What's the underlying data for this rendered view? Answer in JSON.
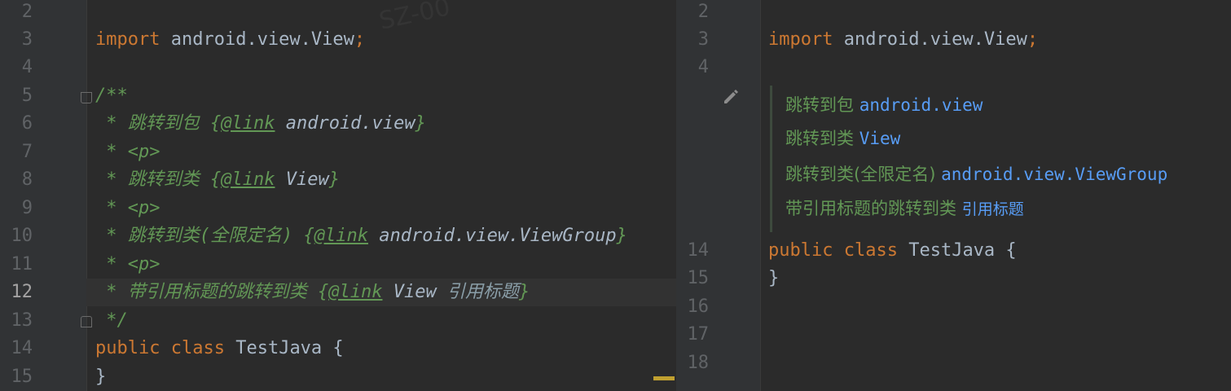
{
  "left": {
    "watermark": "SZ-00",
    "line_numbers": [
      "2",
      "3",
      "4",
      "5",
      "6",
      "7",
      "8",
      "9",
      "10",
      "11",
      "12",
      "13",
      "14",
      "15"
    ],
    "current_line": "12",
    "code": {
      "l3": {
        "import": "import",
        "pkg": " android.view.View",
        "semi": ";"
      },
      "l5": "/**",
      "l6": {
        "star": " * 跳转到包 ",
        "open": "{",
        "tag": "@link",
        "name": " android.view",
        "close": "}"
      },
      "l7": {
        "star": " * ",
        "p": "<p>"
      },
      "l8": {
        "star": " * 跳转到类 ",
        "open": "{",
        "tag": "@link",
        "name": " View",
        "close": "}"
      },
      "l9": {
        "star": " * ",
        "p": "<p>"
      },
      "l10": {
        "star": " * 跳转到类(全限定名) ",
        "open": "{",
        "tag": "@link",
        "name": " android.view.ViewGroup",
        "close": "}"
      },
      "l11": {
        "star": " * ",
        "p": "<p>"
      },
      "l12": {
        "star": " * 带引用标题的跳转到类 ",
        "open": "{",
        "tag": "@link",
        "name": " View",
        "label": " 引用标题",
        "close": "}"
      },
      "l13": " */",
      "l14": {
        "public": "public",
        "class": " class",
        "name": " TestJava",
        "brace": " {"
      },
      "l15": "}"
    }
  },
  "right": {
    "line_numbers_top": [
      "2",
      "3",
      "4"
    ],
    "line_numbers_bottom": [
      "14",
      "15",
      "16",
      "17",
      "18"
    ],
    "code": {
      "l3": {
        "import": "import",
        "pkg": " android.view.View",
        "semi": ";"
      },
      "l14": {
        "public": "public",
        "class": " class",
        "name": " TestJava",
        "brace": " {"
      },
      "l15": "}"
    },
    "rendered_doc": [
      {
        "text": "跳转到包 ",
        "link": "android.view"
      },
      {
        "text": "跳转到类 ",
        "link": "View"
      },
      {
        "text": "跳转到类(全限定名) ",
        "link": "android.view.ViewGroup"
      },
      {
        "text": "带引用标题的跳转到类 ",
        "link": "引用标题"
      }
    ],
    "edit_icon": "pencil-icon"
  },
  "colors": {
    "background": "#2b2b2b",
    "gutter": "#313335",
    "keyword": "#cc7832",
    "doc_comment": "#629755",
    "link": "#589df6",
    "marker": "#c0a030"
  }
}
